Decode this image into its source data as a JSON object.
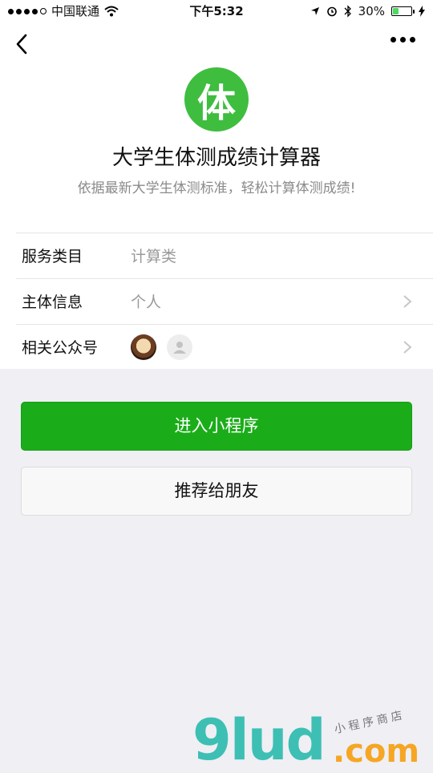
{
  "status_bar": {
    "carrier": "中国联通",
    "time": "下午5:32",
    "battery_percent": "30%",
    "battery_level": 0.3
  },
  "app": {
    "logo_char": "体",
    "title": "大学生体测成绩计算器",
    "description": "依据最新大学生体测标准，轻松计算体测成绩!"
  },
  "info": {
    "category_label": "服务类目",
    "category_value": "计算类",
    "subject_label": "主体信息",
    "subject_value": "个人",
    "related_label": "相关公众号"
  },
  "buttons": {
    "enter": "进入小程序",
    "recommend": "推荐给朋友"
  },
  "watermark": {
    "brand": "9lud",
    "domain": ".com",
    "tagline": "小程序商店"
  },
  "colors": {
    "primary_green": "#1aad19",
    "logo_green": "#3fbd3f",
    "watermark_teal": "#3dbfb4",
    "watermark_orange": "#f5a623"
  }
}
